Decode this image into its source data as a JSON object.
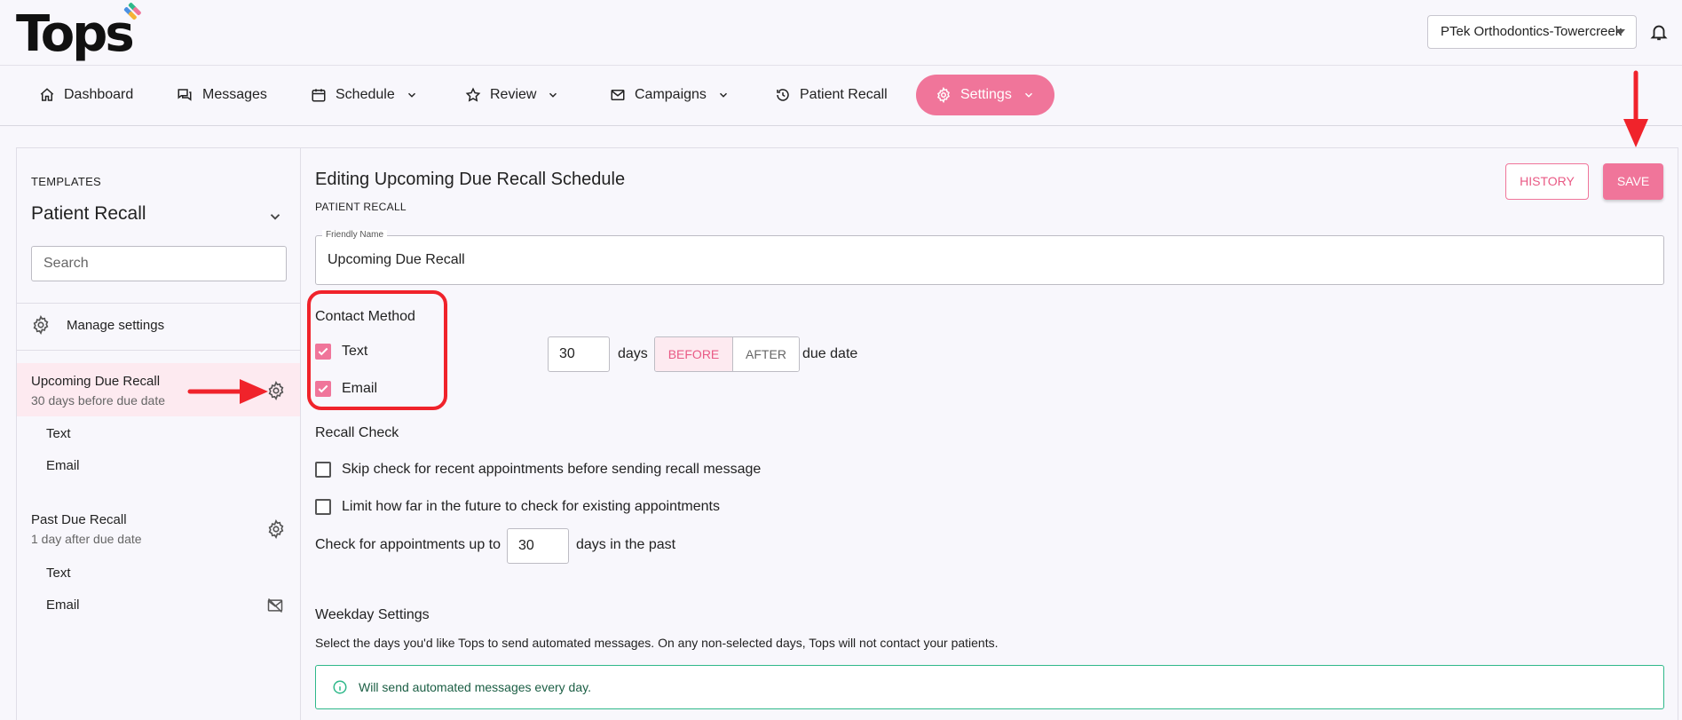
{
  "header": {
    "logo_text": "Tops",
    "practice": "PTek Orthodontics-Towercreek"
  },
  "nav": {
    "dashboard": "Dashboard",
    "messages": "Messages",
    "schedule": "Schedule",
    "review": "Review",
    "campaigns": "Campaigns",
    "patient_recall": "Patient Recall",
    "settings": "Settings"
  },
  "sidebar": {
    "templates_label": "TEMPLATES",
    "selected_template": "Patient Recall",
    "search_placeholder": "Search",
    "manage_settings": "Manage settings",
    "items": [
      {
        "title": "Upcoming Due Recall",
        "subtitle": "30 days before due date",
        "channels": [
          "Text",
          "Email"
        ]
      },
      {
        "title": "Past Due Recall",
        "subtitle": "1 day after due date",
        "channels": [
          "Text",
          "Email"
        ]
      }
    ]
  },
  "main": {
    "title": "Editing Upcoming Due Recall Schedule",
    "subtitle": "PATIENT RECALL",
    "history_button": "HISTORY",
    "save_button": "SAVE",
    "friendly_name_label": "Friendly Name",
    "friendly_name_value": "Upcoming Due Recall",
    "contact_method_label": "Contact Method",
    "contact_text": "Text",
    "contact_email": "Email",
    "contact_text_checked": true,
    "contact_email_checked": true,
    "days_value": "30",
    "days_label": "days",
    "before_label": "BEFORE",
    "after_label": "AFTER",
    "timing_selected": "BEFORE",
    "due_date_label": "due date",
    "recall_check_label": "Recall Check",
    "skip_check_label": "Skip check for recent appointments before sending recall message",
    "limit_label": "Limit how far in the future to check for existing appointments",
    "check_up_to_label": "Check for appointments up to",
    "past_days_value": "30",
    "days_in_past_label": "days in the past",
    "weekday_label": "Weekday Settings",
    "weekday_desc": "Select the days you'd like Tops to send automated messages. On any non-selected days, Tops will not contact your patients.",
    "info_message": "Will send automated messages every day."
  },
  "colors": {
    "accent": "#f0759a",
    "annotation_red": "#f0232b",
    "info_green": "#2fb88a"
  }
}
